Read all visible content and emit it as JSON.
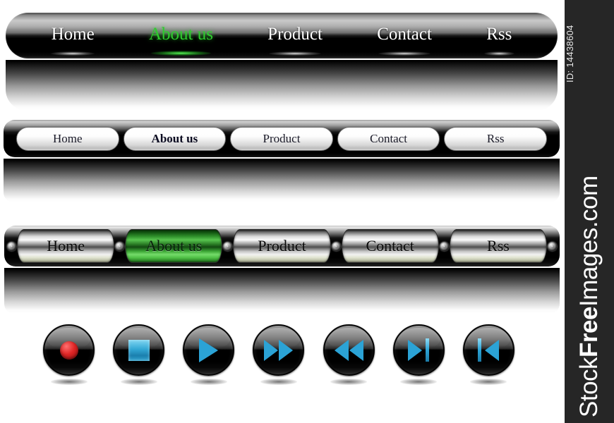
{
  "watermark": {
    "id_text": "ID: 14438604",
    "site_prefix": "Stock",
    "site_bold": "Free",
    "site_suffix": "Images.com",
    "background_color": "#262626",
    "text_color": "#ffffff"
  },
  "navbar_glossy_black": {
    "style_name": "glossy-black-bar",
    "accent_color": "#2ecb2e",
    "items": [
      {
        "label": "Home",
        "active": false
      },
      {
        "label": "About us",
        "active": true
      },
      {
        "label": "Product",
        "active": false
      },
      {
        "label": "Contact",
        "active": false
      },
      {
        "label": "Rss",
        "active": false
      }
    ]
  },
  "navbar_white_pills": {
    "style_name": "white-pill-bar",
    "items": [
      {
        "label": "Home",
        "active": false
      },
      {
        "label": "About us",
        "active": true
      },
      {
        "label": "Product",
        "active": false
      },
      {
        "label": "Contact",
        "active": false
      },
      {
        "label": "Rss",
        "active": false
      }
    ]
  },
  "navbar_chrome": {
    "style_name": "chrome-metal-bar",
    "accent_color": "#58c44f",
    "items": [
      {
        "label": "Home",
        "active": false
      },
      {
        "label": "About us",
        "active": true
      },
      {
        "label": "Product",
        "active": false
      },
      {
        "label": "Contact",
        "active": false
      },
      {
        "label": "Rss",
        "active": false
      }
    ]
  },
  "media_buttons": {
    "accent_color": "#2ba3d6",
    "record_color": "#e02626",
    "items": [
      {
        "name": "record-button",
        "icon": "record-icon"
      },
      {
        "name": "stop-button",
        "icon": "stop-icon"
      },
      {
        "name": "play-button",
        "icon": "play-icon"
      },
      {
        "name": "fast-forward-button",
        "icon": "fast-forward-icon"
      },
      {
        "name": "rewind-button",
        "icon": "rewind-icon"
      },
      {
        "name": "next-track-button",
        "icon": "next-track-icon"
      },
      {
        "name": "previous-track-button",
        "icon": "previous-track-icon"
      }
    ]
  }
}
